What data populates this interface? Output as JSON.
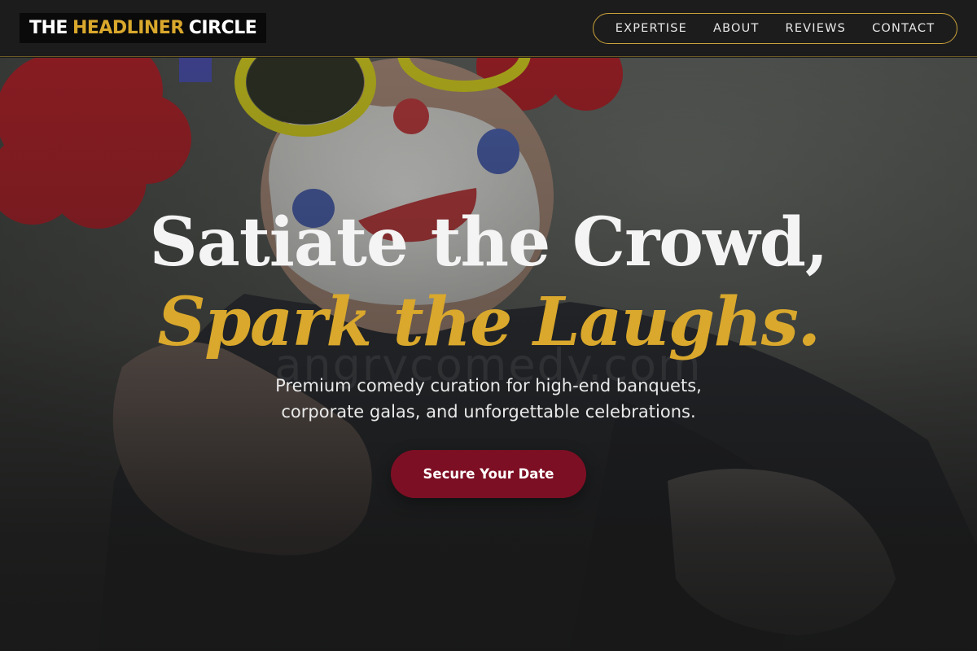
{
  "brand": {
    "prefix": "THE",
    "highlight": "HEADLINER",
    "suffix": "CIRCLE",
    "accent_color": "#d9a82c"
  },
  "nav": {
    "items": [
      {
        "label": "EXPERTISE"
      },
      {
        "label": "ABOUT"
      },
      {
        "label": "REVIEWS"
      },
      {
        "label": "CONTACT"
      }
    ]
  },
  "hero": {
    "headline_line1": "Satiate the Crowd,",
    "headline_line2": "Spark the Laughs.",
    "subtext_line1": "Premium comedy curation for high-end banquets,",
    "subtext_line2": "corporate galas, and unforgettable celebrations.",
    "cta_label": "Secure Your Date",
    "cta_color": "#7d0f24",
    "watermark": "angrycomedy.com"
  }
}
